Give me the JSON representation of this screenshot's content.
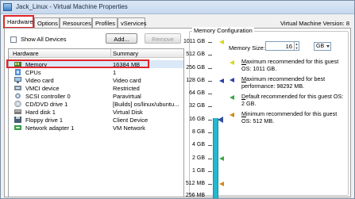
{
  "window": {
    "title": "Jack_Linux - Virtual Machine Properties"
  },
  "tabs": [
    {
      "label": "Hardware",
      "active": true
    },
    {
      "label": "Options",
      "active": false
    },
    {
      "label": "Resources",
      "active": false
    },
    {
      "label": "Profiles",
      "active": false
    },
    {
      "label": "vServices",
      "active": false
    }
  ],
  "vm_version": "Virtual Machine Version: 8",
  "toolbar": {
    "show_all_devices": "Show All Devices",
    "show_all_checked": false,
    "add_label": "Add...",
    "remove_label": "Remove"
  },
  "hardware_table": {
    "columns": [
      "Hardware",
      "Summary"
    ],
    "rows": [
      {
        "name": "Memory",
        "summary": "16384 MB",
        "icon": "memory-icon",
        "selected": true
      },
      {
        "name": "CPUs",
        "summary": "1",
        "icon": "cpu-icon",
        "selected": false
      },
      {
        "name": "Video card",
        "summary": "Video card",
        "icon": "video-card-icon",
        "selected": false
      },
      {
        "name": "VMCI device",
        "summary": "Restricted",
        "icon": "vmci-device-icon",
        "selected": false
      },
      {
        "name": "SCSI controller 0",
        "summary": "Paravirtual",
        "icon": "scsi-controller-icon",
        "selected": false
      },
      {
        "name": "CD/DVD drive 1",
        "summary": "[Builds] os/linux/ubuntu...",
        "icon": "cd-dvd-icon",
        "selected": false
      },
      {
        "name": "Hard disk 1",
        "summary": "Virtual Disk",
        "icon": "hard-disk-icon",
        "selected": false
      },
      {
        "name": "Floppy drive 1",
        "summary": "Client Device",
        "icon": "floppy-icon",
        "selected": false
      },
      {
        "name": "Network adapter 1",
        "summary": "VM Network",
        "icon": "network-adapter-icon",
        "selected": false
      }
    ]
  },
  "memory_config": {
    "group_title": "Memory Configuration",
    "memory_size_label": "Memory Size:",
    "memory_size_value": "16",
    "unit": "GB",
    "scale_labels": [
      "1011 GB",
      "512 GB",
      "256 GB",
      "128 GB",
      "64 GB",
      "32 GB",
      "16 GB",
      "8 GB",
      "4 GB",
      "2 GB",
      "1 GB",
      "512 MB",
      "256 MB"
    ],
    "info": [
      {
        "prefix": "M",
        "text": "aximum recommended for this guest OS: 1011 GB.",
        "color": "#d8d820"
      },
      {
        "prefix": "M",
        "text": "aximum recommended for best performance: 98292 MB.",
        "color": "#2a3fa8"
      },
      {
        "prefix": "D",
        "text": "efault recommended for this guest OS: 2 GB.",
        "color": "#3da645"
      },
      {
        "prefix": "M",
        "text": "inimum recommended for this guest OS: 512 MB.",
        "color": "#d08a1e"
      }
    ]
  },
  "colors": {
    "highlight": "#e0252b",
    "scale_bar": "#22b8d0"
  }
}
